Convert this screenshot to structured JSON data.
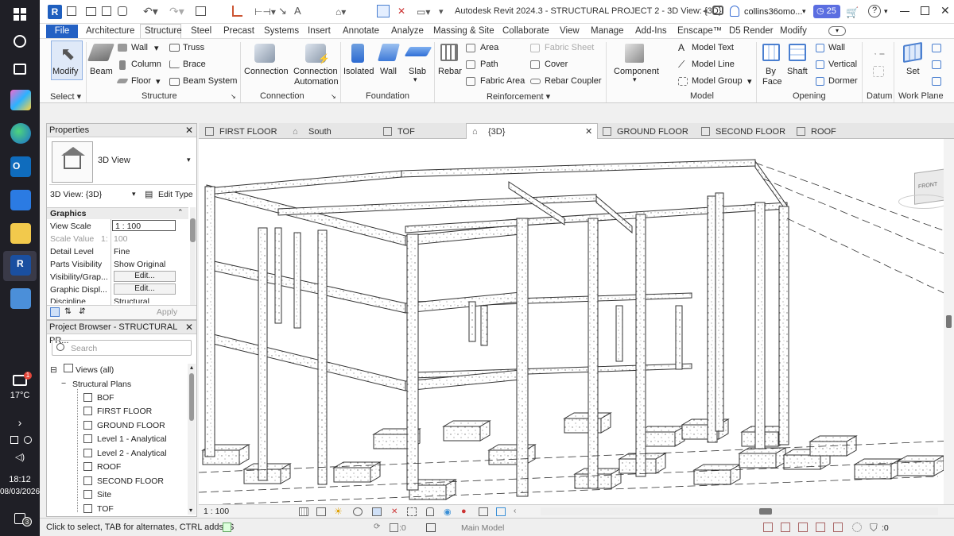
{
  "os": {
    "weather": "17°C",
    "time": "18:12",
    "date": "08/03/2026",
    "weather_badge": "1",
    "notification_badge": "3"
  },
  "title_bar": {
    "title": "Autodesk Revit 2024.3 - STRUCTURAL PROJECT 2 - 3D View: {3D}",
    "user": "collins36omo...",
    "trial_days": "25",
    "app_icon": "R"
  },
  "ribbon_tabs": [
    "File",
    "Architecture",
    "Structure",
    "Steel",
    "Precast",
    "Systems",
    "Insert",
    "Annotate",
    "Analyze",
    "Massing & Site",
    "Collaborate",
    "View",
    "Manage",
    "Add-Ins",
    "Enscape™",
    "D5 Render",
    "Modify"
  ],
  "ribbon": {
    "modify": "Modify",
    "beam": "Beam",
    "wall": "Wall",
    "column": "Column",
    "floor": "Floor",
    "truss": "Truss",
    "brace": "Brace",
    "beam_system": "Beam System",
    "connection": "Connection",
    "connection_automation_1": "Connection",
    "connection_automation_2": "Automation",
    "isolated": "Isolated",
    "found_wall": "Wall",
    "slab": "Slab",
    "rebar": "Rebar",
    "area": "Area",
    "path": "Path",
    "fabric_area": "Fabric Area",
    "fabric_sheet": "Fabric Sheet",
    "cover": "Cover",
    "rebar_coupler": "Rebar Coupler",
    "component": "Component",
    "model_text": "Model Text",
    "model_line": "Model Line",
    "model_group": "Model Group",
    "by_face_1": "By",
    "by_face_2": "Face",
    "shaft": "Shaft",
    "op_wall": "Wall",
    "vertical": "Vertical",
    "dormer": "Dormer",
    "datum": "Datum",
    "set": "Set",
    "work_plane": "Work Plane",
    "groups": {
      "select": "Select",
      "structure": "Structure",
      "connection": "Connection",
      "foundation": "Foundation",
      "reinforcement": "Reinforcement",
      "model": "Model",
      "opening": "Opening"
    }
  },
  "properties": {
    "title": "Properties",
    "type_name": "3D View",
    "instance": "3D View: {3D}",
    "edit_type": "Edit Type",
    "section": "Graphics",
    "rows": [
      {
        "label": "View Scale",
        "value": "1 : 100"
      },
      {
        "label": "Scale Value",
        "prefix": "1:",
        "value": "100"
      },
      {
        "label": "Detail Level",
        "value": "Fine"
      },
      {
        "label": "Parts Visibility",
        "value": "Show Original"
      },
      {
        "label": "Visibility/Grap...",
        "value": "Edit..."
      },
      {
        "label": "Graphic Displ...",
        "value": "Edit..."
      },
      {
        "label": "Discipline",
        "value": "Structural"
      }
    ],
    "apply": "Apply"
  },
  "project_browser": {
    "title": "Project Browser - STRUCTURAL PR...",
    "search_placeholder": "Search",
    "views_root": "Views (all)",
    "group": "Structural Plans",
    "items": [
      "BOF",
      "FIRST FLOOR",
      "GROUND FLOOR",
      "Level 1 - Analytical",
      "Level 2 - Analytical",
      "ROOF",
      "SECOND FLOOR",
      "Site",
      "TOF"
    ]
  },
  "view_tabs": [
    "FIRST FLOOR",
    "South",
    "TOF",
    "{3D}",
    "GROUND FLOOR",
    "SECOND FLOOR",
    "ROOF"
  ],
  "active_view_tab": "{3D}",
  "viewcube_label": "FRONT",
  "view_scale": "1 : 100",
  "status": {
    "hint": "Click to select, TAB for alternates, CTRL adds, S",
    "count": ":0",
    "model": "Main Model",
    "filter": ":0"
  }
}
